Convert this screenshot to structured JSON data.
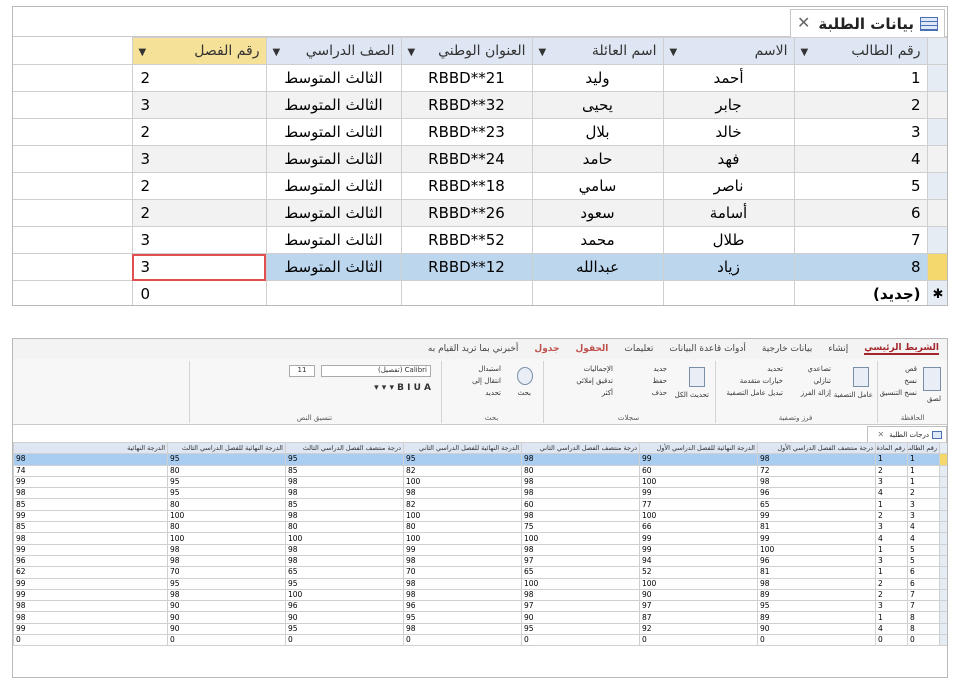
{
  "table1": {
    "tab_title": "بيانات الطلبة",
    "close_glyph": "✕",
    "columns": [
      "رقم الطالب",
      "الاسم",
      "اسم العائلة",
      "العنوان الوطني",
      "الصف الدراسي",
      "رقم الفصل"
    ],
    "rows": [
      [
        "1",
        "أحمد",
        "وليد",
        "RBBD**21",
        "الثالث المتوسط",
        "2"
      ],
      [
        "2",
        "جابر",
        "يحيى",
        "RBBD**32",
        "الثالث المتوسط",
        "3"
      ],
      [
        "3",
        "خالد",
        "بلال",
        "RBBD**23",
        "الثالث المتوسط",
        "2"
      ],
      [
        "4",
        "فهد",
        "حامد",
        "RBBD**24",
        "الثالث المتوسط",
        "3"
      ],
      [
        "5",
        "ناصر",
        "سامي",
        "RBBD**18",
        "الثالث المتوسط",
        "2"
      ],
      [
        "6",
        "أسامة",
        "سعود",
        "RBBD**26",
        "الثالث المتوسط",
        "2"
      ],
      [
        "7",
        "طلال",
        "محمد",
        "RBBD**52",
        "الثالث المتوسط",
        "3"
      ],
      [
        "8",
        "زياد",
        "عبدالله",
        "RBBD**12",
        "الثالث المتوسط",
        "3"
      ]
    ],
    "new_row_marker": "✱",
    "new_row_label": "(جديد)",
    "new_row_value": "0"
  },
  "ribbon": {
    "tabs": [
      "الشريط الرئيسي",
      "إنشاء",
      "بيانات خارجية",
      "أدوات قاعدة البيانات",
      "تعليمات",
      "الحقول",
      "جدول",
      "أخبرني بما تريد القيام به"
    ],
    "groups": [
      "الحافظة",
      "فرز وتصفية",
      "سجلات",
      "بحث",
      "تنسيق النص"
    ],
    "buttons": {
      "paste": "لصق",
      "cut": "قص",
      "copy": "نسخ",
      "format_painter": "نسخ التنسيق",
      "filter": "عامل التصفية",
      "ascending": "تصاعدي",
      "descending": "تنازلي",
      "remove_sort": "إزالة الفرز",
      "selection": "تحديد",
      "advanced": "خيارات متقدمة",
      "toggle_filter": "تبديل عامل التصفية",
      "refresh_all": "تحديث الكل",
      "new": "جديد",
      "save": "حفظ",
      "delete": "حذف",
      "totals": "الإجماليات",
      "spelling": "تدقيق إملائي",
      "more": "أكثر",
      "find": "بحث",
      "replace": "استبدال",
      "go_to": "انتقال إلى",
      "select": "تحديد",
      "font_name": "Calibri (تفصيل)",
      "font_size": "11"
    }
  },
  "table2": {
    "tab_title": "درجات الطلبة",
    "columns": [
      "رقم الطالب",
      "رقم المادة",
      "درجة منتصف الفصل الدراسي الأول",
      "الدرجة النهائية للفصل الدراسي الأول",
      "درجة منتصف الفصل الدراسي الثاني",
      "الدرجة النهائية للفصل الدراسي الثاني",
      "درجة منتصف الفصل الدراسي الثالث",
      "الدرجة النهائية للفصل الدراسي الثالث",
      "الدرجة النهائية"
    ],
    "rows": [
      [
        "1",
        "1",
        "98",
        "99",
        "98",
        "95",
        "95",
        "95",
        "98"
      ],
      [
        "1",
        "2",
        "72",
        "60",
        "80",
        "82",
        "85",
        "80",
        "74"
      ],
      [
        "1",
        "3",
        "98",
        "100",
        "98",
        "100",
        "98",
        "95",
        "99"
      ],
      [
        "2",
        "4",
        "96",
        "99",
        "98",
        "98",
        "98",
        "95",
        "98"
      ],
      [
        "3",
        "1",
        "65",
        "77",
        "60",
        "82",
        "85",
        "80",
        "85"
      ],
      [
        "3",
        "2",
        "99",
        "100",
        "98",
        "100",
        "98",
        "100",
        "99"
      ],
      [
        "4",
        "3",
        "81",
        "66",
        "75",
        "80",
        "80",
        "80",
        "85"
      ],
      [
        "4",
        "4",
        "99",
        "99",
        "100",
        "100",
        "100",
        "100",
        "98"
      ],
      [
        "5",
        "1",
        "100",
        "99",
        "98",
        "99",
        "98",
        "98",
        "99"
      ],
      [
        "5",
        "3",
        "96",
        "94",
        "97",
        "98",
        "98",
        "98",
        "96"
      ],
      [
        "6",
        "1",
        "81",
        "52",
        "65",
        "70",
        "65",
        "70",
        "62"
      ],
      [
        "6",
        "2",
        "98",
        "100",
        "100",
        "98",
        "95",
        "95",
        "99"
      ],
      [
        "7",
        "2",
        "89",
        "90",
        "98",
        "98",
        "100",
        "98",
        "99"
      ],
      [
        "7",
        "3",
        "95",
        "97",
        "97",
        "96",
        "96",
        "90",
        "98"
      ],
      [
        "8",
        "1",
        "89",
        "87",
        "90",
        "95",
        "90",
        "90",
        "98"
      ],
      [
        "8",
        "4",
        "90",
        "92",
        "95",
        "98",
        "95",
        "90",
        "99"
      ]
    ],
    "new_row": [
      "0",
      "0",
      "0",
      "0",
      "0",
      "0",
      "0",
      "0",
      "0"
    ]
  }
}
